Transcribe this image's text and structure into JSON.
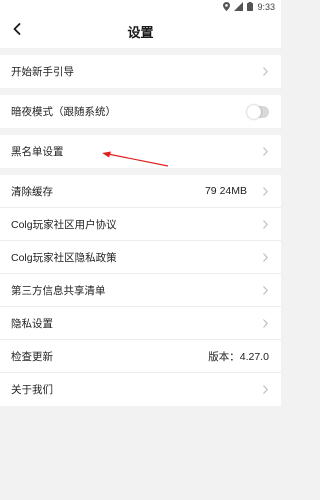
{
  "status_bar": {
    "time": "9:33",
    "icons": [
      "location-icon",
      "signal-icon",
      "battery-icon"
    ]
  },
  "header": {
    "title": "设置",
    "back_icon": "chevron-left-icon"
  },
  "groups": [
    {
      "items": [
        {
          "label": "开始新手引导",
          "control": "chevron"
        }
      ]
    },
    {
      "items": [
        {
          "label": "暗夜模式（跟随系统）",
          "control": "toggle",
          "toggle_on": false
        }
      ]
    },
    {
      "items": [
        {
          "label": "黑名单设置",
          "control": "chevron"
        }
      ]
    },
    {
      "items": [
        {
          "label": "清除缓存",
          "value": "79 24MB",
          "control": "chevron"
        },
        {
          "label": "Colg玩家社区用户协议",
          "control": "chevron"
        },
        {
          "label": "Colg玩家社区隐私政策",
          "control": "chevron"
        },
        {
          "label": "第三方信息共享清单",
          "control": "chevron"
        },
        {
          "label": "隐私设置",
          "control": "chevron"
        },
        {
          "label": "检查更新",
          "value": "版本：4.27.0",
          "control": "none"
        },
        {
          "label": "关于我们",
          "control": "chevron"
        }
      ]
    }
  ],
  "colors": {
    "page_bg": "#f2f2f2",
    "row_bg": "#ffffff",
    "divider": "#ececec",
    "chevron": "#b5b5b5",
    "annotation_arrow": "#e0201e"
  }
}
